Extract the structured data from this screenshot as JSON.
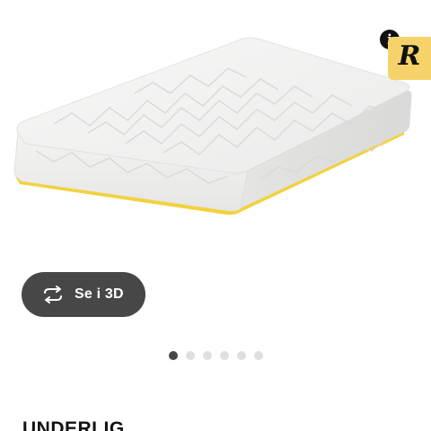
{
  "product": {
    "image_alt": "UNDERLIG mattress",
    "title": "UNDERLIG"
  },
  "badges": {
    "info_label": "i",
    "brand_letter": "R",
    "brand_color": "#f6d36a"
  },
  "view3d": {
    "label": "Se i 3D",
    "icon": "rotate-icon"
  },
  "carousel": {
    "total": 6,
    "active_index": 0
  },
  "colors": {
    "button_bg": "#474747",
    "dot_active": "#484848",
    "dot_inactive": "#dfdfdf",
    "accent_yellow": "#f2d23c"
  }
}
